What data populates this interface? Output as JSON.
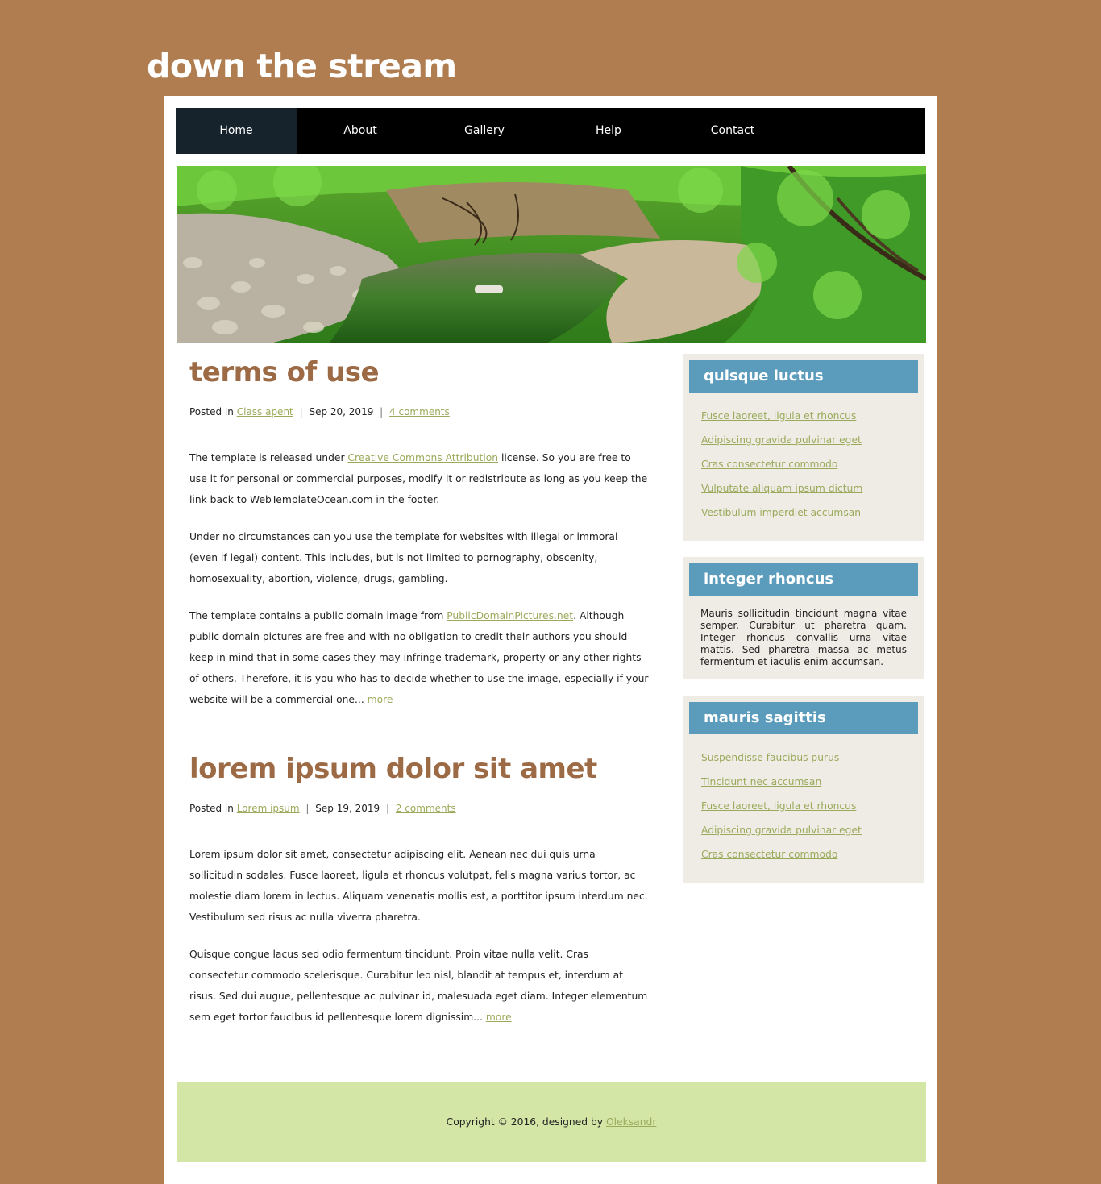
{
  "site": {
    "title": "down the stream"
  },
  "nav": {
    "items": [
      {
        "label": "Home"
      },
      {
        "label": "About"
      },
      {
        "label": "Gallery"
      },
      {
        "label": "Help"
      },
      {
        "label": "Contact"
      }
    ],
    "active": "Home"
  },
  "posts": [
    {
      "title": "terms of use",
      "posted_in": "Posted in",
      "category": "Class apent",
      "date": "Sep 20, 2019",
      "comments": "4 comments",
      "p1_before": "The template is released under ",
      "p1_link": "Creative Commons Attribution",
      "p1_after": " license. So you are free to use it for personal or commercial purposes, modify it or redistribute as long as you keep the link back to WebTemplateOcean.com in the footer.",
      "p2": "Under no circumstances can you use the template for websites with illegal or immoral (even if legal) content. This includes, but is not limited to pornography, obscenity, homosexuality, abortion, violence, drugs, gambling.",
      "p3_before": "The template contains a public domain image from ",
      "p3_link": "PublicDomainPictures.net",
      "p3_after": ". Although public domain pictures are free and with no obligation to credit their authors you should keep in mind that in some cases they may infringe trademark, property or any other rights of others. Therefore, it is you who has to decide whether to use the image, especially if your website will be a commercial one... ",
      "more": "more"
    },
    {
      "title": "lorem ipsum dolor sit amet",
      "posted_in": "Posted in",
      "category": "Lorem ipsum",
      "date": "Sep 19, 2019",
      "comments": "2 comments",
      "p1": "Lorem ipsum dolor sit amet, consectetur adipiscing elit. Aenean nec dui quis urna sollicitudin sodales. Fusce laoreet, ligula et rhoncus volutpat, felis magna varius tortor, ac molestie diam lorem in lectus. Aliquam venenatis mollis est, a porttitor ipsum interdum nec. Vestibulum sed risus ac nulla viverra pharetra.",
      "p2_before": "Quisque congue lacus sed odio fermentum tincidunt. Proin vitae nulla velit. Cras consectetur commodo scelerisque. Curabitur leo nisl, blandit at tempus et, interdum at risus. Sed dui augue, pellentesque ac pulvinar id, malesuada eget diam. Integer elementum sem eget tortor faucibus id pellentesque lorem dignissim... ",
      "more": "more"
    }
  ],
  "sidebar": {
    "w1": {
      "title": "quisque luctus",
      "links": [
        "Fusce laoreet, ligula et rhoncus",
        "Adipiscing gravida pulvinar eget",
        "Cras consectetur commodo",
        "Vulputate aliquam ipsum dictum",
        "Vestibulum imperdiet accumsan"
      ]
    },
    "w2": {
      "title": "integer rhoncus",
      "text": "Mauris sollicitudin tincidunt magna vitae semper. Curabitur ut pharetra quam. Integer rhoncus convallis urna vitae mattis. Sed pharetra massa ac metus fermentum et iaculis enim accumsan."
    },
    "w3": {
      "title": "mauris sagittis",
      "links": [
        "Suspendisse faucibus purus",
        "Tincidunt nec accumsan",
        "Fusce laoreet, ligula et rhoncus",
        "Adipiscing gravida pulvinar eget",
        "Cras consectetur commodo"
      ]
    }
  },
  "footer": {
    "text": "Copyright © 2016, designed by ",
    "link": "Oleksandr"
  },
  "colors": {
    "page_bg": "#b07d50",
    "post_title": "#9c6a44",
    "link": "#9aaa5a",
    "widget_header": "#5b9cbd",
    "widget_bg": "#efece6",
    "footer_bg": "#d3e6a6",
    "nav_bg": "#000000",
    "nav_active": "#17232c"
  }
}
